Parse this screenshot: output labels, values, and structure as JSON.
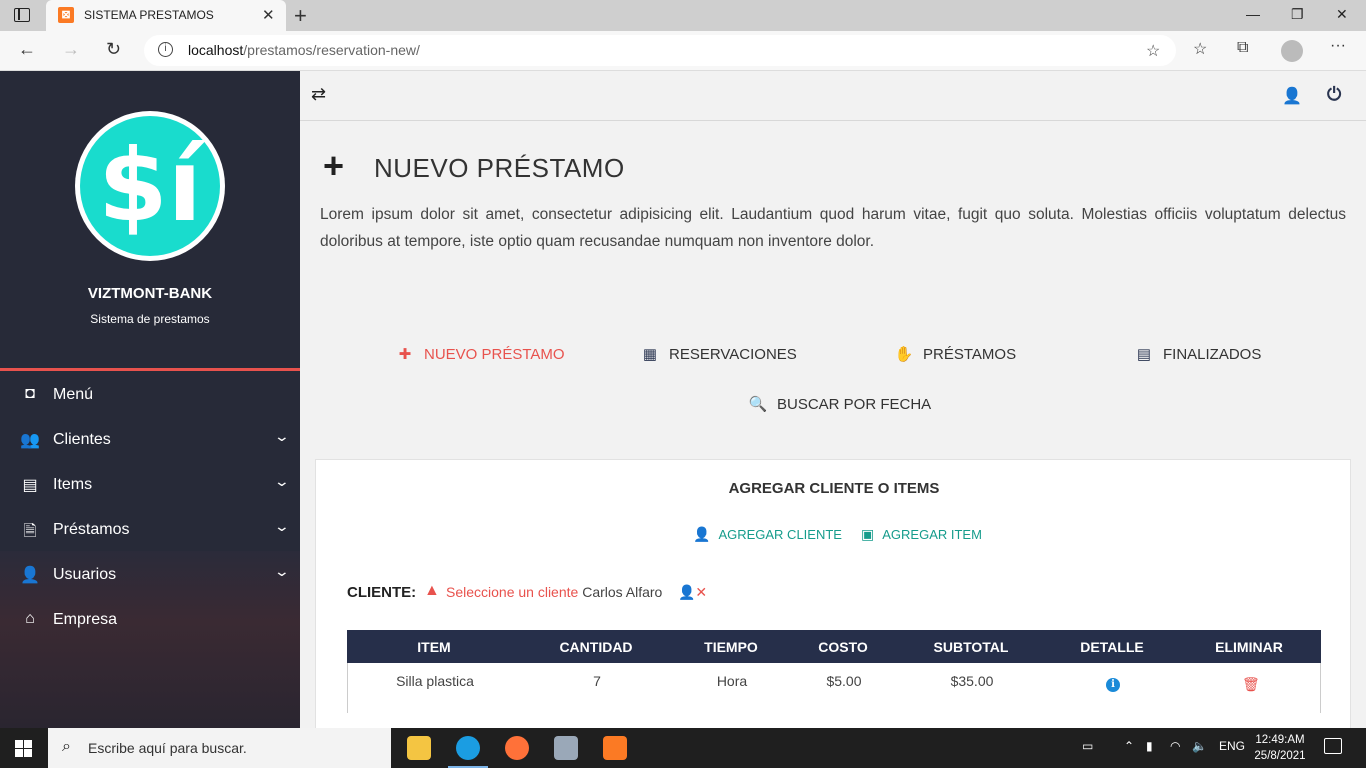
{
  "browser": {
    "tab_title": "SISTEMA PRESTAMOS",
    "tab_favicon": "⊠",
    "url_host": "localhost",
    "url_path": "/prestamos/reservation-new/"
  },
  "sidebar": {
    "logo_text": "$í",
    "brand": "VIZTMONT-BANK",
    "subtitle": "Sistema de prestamos",
    "items": [
      {
        "label": "Menú",
        "icon": "tablet-icon",
        "glyph": "◘",
        "expandable": false
      },
      {
        "label": "Clientes",
        "icon": "users-icon",
        "glyph": "👥",
        "expandable": true
      },
      {
        "label": "Items",
        "icon": "pallet-icon",
        "glyph": "▤",
        "expandable": true
      },
      {
        "label": "Préstamos",
        "icon": "file-invoice-dollar-icon",
        "glyph": "🗎",
        "expandable": true
      },
      {
        "label": "Usuarios",
        "icon": "user-secret-icon",
        "glyph": "👤",
        "expandable": true
      },
      {
        "label": "Empresa",
        "icon": "store-icon",
        "glyph": "⌂",
        "expandable": false
      }
    ]
  },
  "topbar": {
    "toggle_icon": "⇄",
    "user_settings_icon": "👤",
    "power_icon": "⏻"
  },
  "page": {
    "title": "NUEVO PRÉSTAMO",
    "description": "Lorem ipsum dolor sit amet, consectetur adipisicing elit. Laudantium quod harum vitae, fugit quo soluta. Molestias officiis voluptatum delectus doloribus at tempore, iste optio quam recusandae numquam non inventore dolor."
  },
  "nav_links": {
    "nuevo": "NUEVO PRÉSTAMO",
    "reservaciones": "RESERVACIONES",
    "prestamos": "PRÉSTAMOS",
    "finalizados": "FINALIZADOS",
    "buscar": "BUSCAR POR FECHA"
  },
  "card": {
    "title": "AGREGAR CLIENTE O ITEMS",
    "add_client": "AGREGAR CLIENTE",
    "add_item": "AGREGAR ITEM",
    "client_label": "CLIENTE:",
    "client_status": "Seleccione un cliente",
    "client_name": "Carlos Alfaro"
  },
  "table": {
    "headers": [
      "ITEM",
      "CANTIDAD",
      "TIEMPO",
      "COSTO",
      "SUBTOTAL",
      "DETALLE",
      "ELIMINAR"
    ],
    "rows": [
      {
        "item": "Silla plastica",
        "cantidad": "7",
        "tiempo": "Hora",
        "costo": "$5.00",
        "subtotal": "$35.00"
      }
    ]
  },
  "taskbar": {
    "search_placeholder": "Escribe aquí para buscar.",
    "lang": "ENG",
    "time": "12:49:AM",
    "date": "25/8/2021"
  },
  "colors": {
    "sidebar_bg": "#272a38",
    "accent_red": "#e8524d",
    "teal": "#169c8c",
    "logo_teal": "#19dccd",
    "table_header": "#262f4a"
  }
}
